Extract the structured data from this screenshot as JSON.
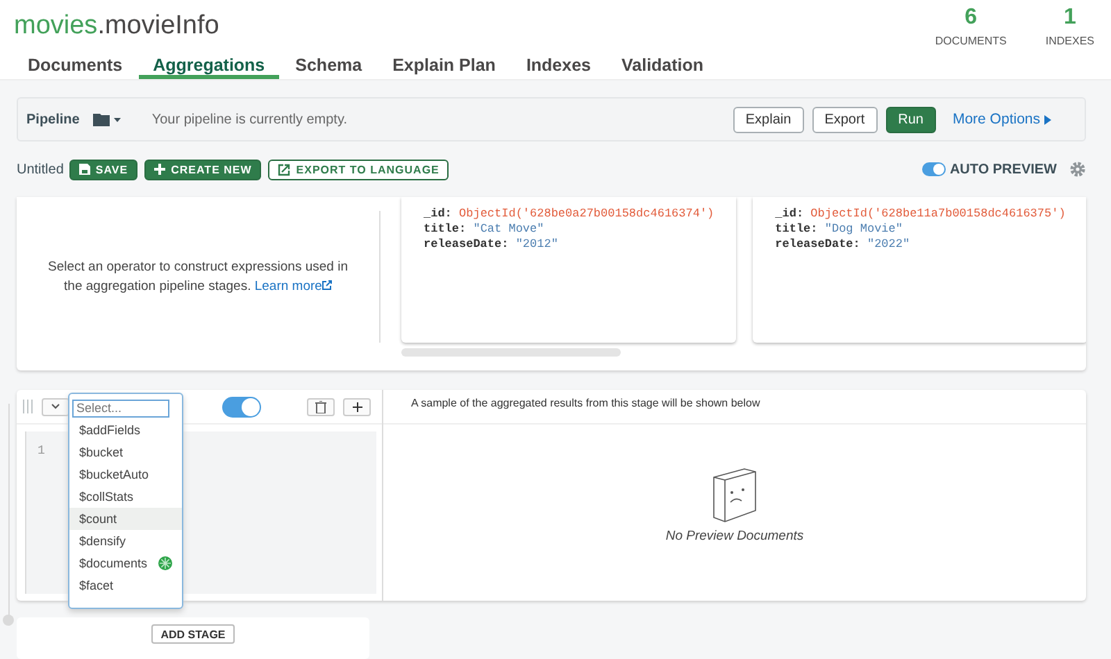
{
  "header": {
    "database": "movies",
    "collection": ".movieInfo",
    "stats": [
      {
        "value": "6",
        "label": "DOCUMENTS"
      },
      {
        "value": "1",
        "label": "INDEXES"
      }
    ]
  },
  "tabs": [
    {
      "label": "Documents",
      "selected": false
    },
    {
      "label": "Aggregations",
      "selected": true
    },
    {
      "label": "Schema",
      "selected": false
    },
    {
      "label": "Explain Plan",
      "selected": false
    },
    {
      "label": "Indexes",
      "selected": false
    },
    {
      "label": "Validation",
      "selected": false
    }
  ],
  "pipeline_bar": {
    "label": "Pipeline",
    "status": "Your pipeline is currently empty.",
    "buttons": [
      {
        "label": "Explain",
        "kind": "outline"
      },
      {
        "label": "Export",
        "kind": "outline"
      },
      {
        "label": "Run",
        "kind": "primary"
      }
    ],
    "more_options": "More Options"
  },
  "toolbar": {
    "name": "Untitled",
    "buttons": [
      {
        "label": "SAVE",
        "kind": "save"
      },
      {
        "label": "CREATE NEW",
        "kind": "create"
      },
      {
        "label": "EXPORT TO LANGUAGE",
        "kind": "export"
      }
    ],
    "auto_preview": {
      "label": "AUTO PREVIEW",
      "on": true
    }
  },
  "preview": {
    "info": "Select an operator to construct expressions used in the aggregation pipeline stages.",
    "link": "Learn more",
    "documents": [
      {
        "fields": [
          {
            "key": "_id:",
            "value": "ObjectId('628be0a27b00158dc4616374')",
            "kind": "objectid"
          },
          {
            "key": "title:",
            "value": "\"Cat Move\"",
            "kind": "string"
          },
          {
            "key": "releaseDate:",
            "value": "\"2012\"",
            "kind": "string"
          }
        ]
      },
      {
        "fields": [
          {
            "key": "_id:",
            "value": "ObjectId('628be11a7b00158dc4616375')",
            "kind": "objectid"
          },
          {
            "key": "title:",
            "value": "\"Dog Movie\"",
            "kind": "string"
          },
          {
            "key": "releaseDate:",
            "value": "\"2022\"",
            "kind": "string"
          }
        ]
      }
    ]
  },
  "stage": {
    "enabled": true,
    "operator_placeholder": "Select...",
    "operators": [
      {
        "label": "$addFields",
        "selected": false,
        "marked": false
      },
      {
        "label": "$bucket",
        "selected": false,
        "marked": false
      },
      {
        "label": "$bucketAuto",
        "selected": false,
        "marked": false
      },
      {
        "label": "$collStats",
        "selected": false,
        "marked": false
      },
      {
        "label": "$count",
        "selected": true,
        "marked": false
      },
      {
        "label": "$densify",
        "selected": false,
        "marked": false
      },
      {
        "label": "$documents",
        "selected": false,
        "marked": true
      },
      {
        "label": "$facet",
        "selected": false,
        "marked": false
      }
    ],
    "line_number": "1",
    "results_hint": "A sample of the aggregated results from this stage will be shown below",
    "empty_message": "No Preview Documents"
  },
  "add_stage": "ADD STAGE"
}
